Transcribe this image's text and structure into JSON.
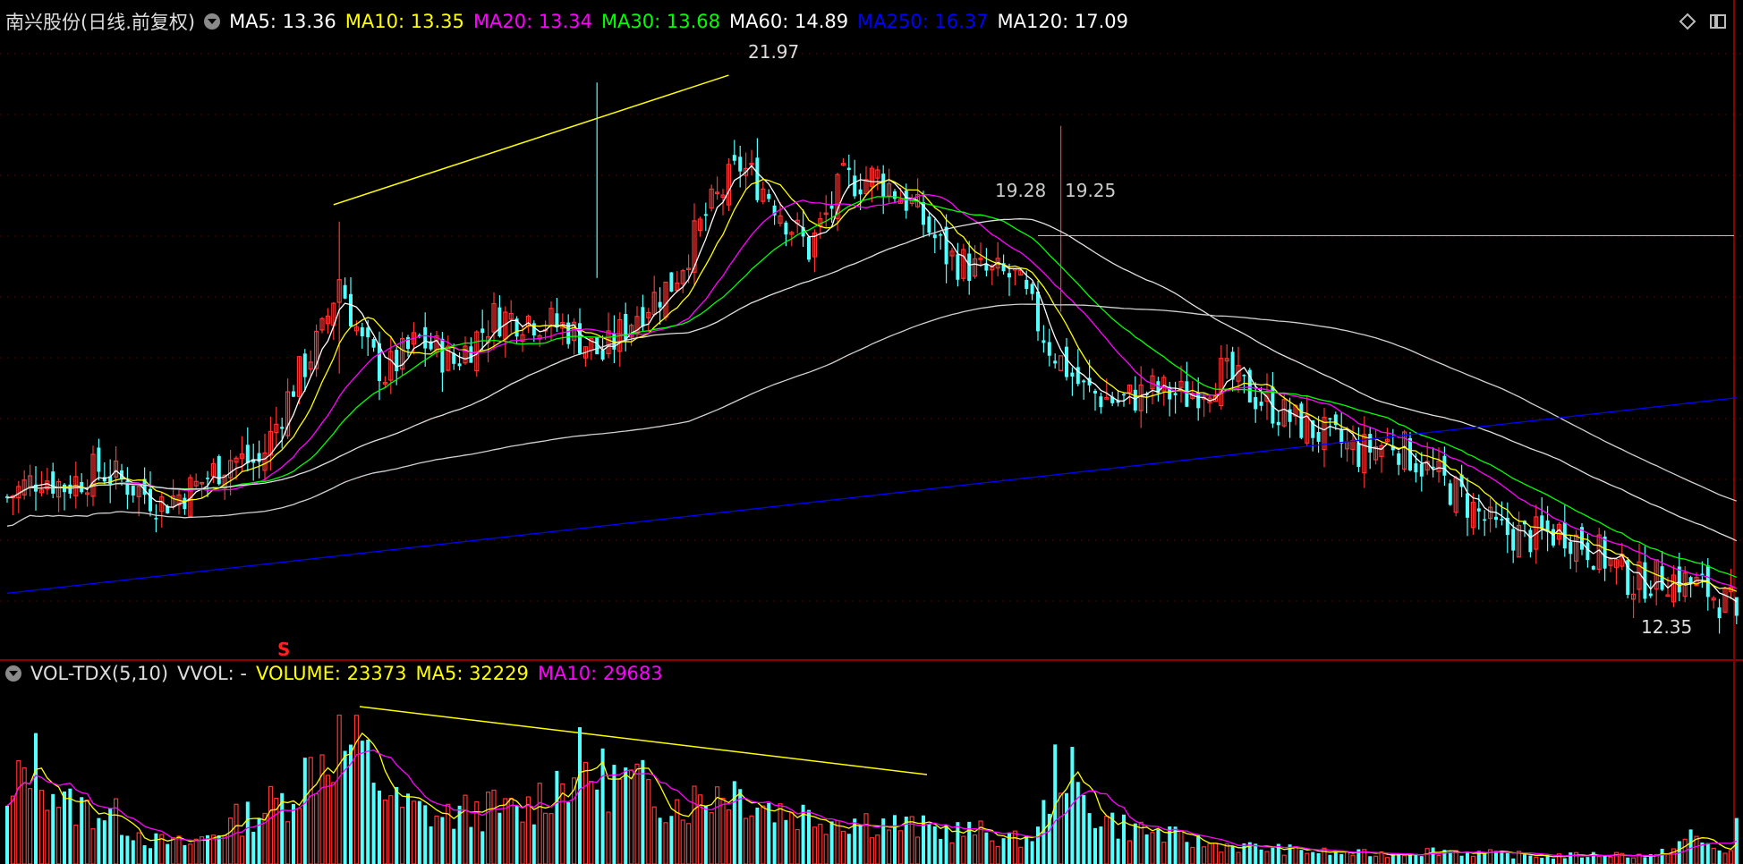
{
  "header": {
    "title": "南兴股份(日线.前复权)",
    "ma_labels": [
      {
        "text": "MA5: 13.36",
        "color": "#ffffff"
      },
      {
        "text": "MA10: 13.35",
        "color": "#ffff00"
      },
      {
        "text": "MA20: 13.34",
        "color": "#ff00ff"
      },
      {
        "text": "MA30: 13.68",
        "color": "#00ff00"
      },
      {
        "text": "MA60: 14.89",
        "color": "#ffffff"
      },
      {
        "text": "MA250: 16.37",
        "color": "#0000ff"
      },
      {
        "text": "MA120: 17.09",
        "color": "#ffffff"
      }
    ]
  },
  "vol_header": {
    "title": "VOL-TDX(5,10)",
    "vvol": "VVOL: -",
    "volume": "VOLUME: 23373",
    "ma5": "MA5: 32229",
    "ma10": "MA10: 29683"
  },
  "annotations": {
    "high": "21.97",
    "low": "12.35",
    "mid1": "19.28",
    "mid2": "19.25",
    "marker": "S"
  },
  "icons": [
    "chevron-down-icon",
    "diamond-icon",
    "window-icon"
  ],
  "colors": {
    "up": "#ff3333",
    "down": "#54ffff",
    "bg": "#000000",
    "grid": "#7a0000"
  },
  "chart_data": [
    {
      "type": "candlestick",
      "title": "南兴股份(日线.前复权)",
      "y_range": [
        12.0,
        22.8
      ],
      "anchors_close": [
        [
          0,
          14.6
        ],
        [
          6,
          15.0
        ],
        [
          10,
          14.8
        ],
        [
          16,
          15.1
        ],
        [
          22,
          14.8
        ],
        [
          27,
          14.5
        ],
        [
          33,
          14.8
        ],
        [
          39,
          15.3
        ],
        [
          44,
          15.2
        ],
        [
          50,
          16.6
        ],
        [
          55,
          17.5
        ],
        [
          58,
          18.5
        ],
        [
          62,
          17.3
        ],
        [
          66,
          16.8
        ],
        [
          72,
          17.4
        ],
        [
          78,
          17.0
        ],
        [
          85,
          17.8
        ],
        [
          91,
          17.8
        ],
        [
          98,
          17.6
        ],
        [
          104,
          17.1
        ],
        [
          110,
          17.9
        ],
        [
          116,
          18.4
        ],
        [
          122,
          19.6
        ],
        [
          128,
          20.5
        ],
        [
          133,
          20.0
        ],
        [
          140,
          19.0
        ],
        [
          146,
          20.2
        ],
        [
          152,
          20.3
        ],
        [
          158,
          19.8
        ],
        [
          164,
          18.9
        ],
        [
          170,
          18.6
        ],
        [
          176,
          18.5
        ],
        [
          182,
          17.3
        ],
        [
          188,
          16.5
        ],
        [
          194,
          16.3
        ],
        [
          200,
          16.5
        ],
        [
          206,
          16.4
        ],
        [
          212,
          16.8
        ],
        [
          218,
          16.4
        ],
        [
          224,
          16.0
        ],
        [
          230,
          15.7
        ],
        [
          236,
          15.4
        ],
        [
          242,
          15.6
        ],
        [
          248,
          15.1
        ],
        [
          254,
          14.6
        ],
        [
          260,
          14.0
        ],
        [
          266,
          13.9
        ],
        [
          272,
          14.0
        ],
        [
          278,
          13.6
        ],
        [
          284,
          13.1
        ],
        [
          290,
          13.2
        ],
        [
          296,
          13.0
        ],
        [
          302,
          12.6
        ]
      ],
      "big_days": [
        {
          "day": 58,
          "high": 19.5,
          "low": 16.8
        },
        {
          "day": 103,
          "high": 21.97,
          "low": 18.5
        },
        {
          "day": 184,
          "high": 21.2,
          "low": 17.9
        }
      ],
      "last": {
        "high": 12.7,
        "low": 12.35,
        "close": 12.5
      },
      "ma_lines": [
        "MA5",
        "MA10",
        "MA20",
        "MA30",
        "MA60",
        "MA250",
        "MA120"
      ]
    },
    {
      "type": "bar",
      "title": "VOL-TDX(5,10)",
      "series": [
        {
          "name": "VOLUME"
        },
        {
          "name": "MA5"
        },
        {
          "name": "MA10"
        }
      ],
      "y_range": [
        0,
        90000
      ],
      "anchors": [
        [
          0,
          25000
        ],
        [
          4,
          55000
        ],
        [
          10,
          30000
        ],
        [
          18,
          26000
        ],
        [
          25,
          12000
        ],
        [
          32,
          10000
        ],
        [
          40,
          22000
        ],
        [
          48,
          32000
        ],
        [
          54,
          52000
        ],
        [
          58,
          62000
        ],
        [
          62,
          55000
        ],
        [
          68,
          30000
        ],
        [
          76,
          24000
        ],
        [
          84,
          28000
        ],
        [
          90,
          26000
        ],
        [
          96,
          42000
        ],
        [
          100,
          50000
        ],
        [
          104,
          44000
        ],
        [
          110,
          40000
        ],
        [
          118,
          30000
        ],
        [
          126,
          40000
        ],
        [
          134,
          28000
        ],
        [
          142,
          24000
        ],
        [
          150,
          22000
        ],
        [
          160,
          18000
        ],
        [
          170,
          16000
        ],
        [
          176,
          12000
        ],
        [
          180,
          16000
        ],
        [
          184,
          56000
        ],
        [
          188,
          30000
        ],
        [
          194,
          20000
        ],
        [
          200,
          16000
        ],
        [
          210,
          10000
        ],
        [
          220,
          8000
        ],
        [
          230,
          6000
        ],
        [
          240,
          5000
        ],
        [
          250,
          7000
        ],
        [
          260,
          5000
        ],
        [
          270,
          4000
        ],
        [
          280,
          5000
        ],
        [
          288,
          4000
        ],
        [
          294,
          14000
        ],
        [
          298,
          8000
        ],
        [
          302,
          6000
        ]
      ],
      "last": {
        "volume": 23373,
        "ma5": 32229,
        "ma10": 29683
      }
    }
  ]
}
